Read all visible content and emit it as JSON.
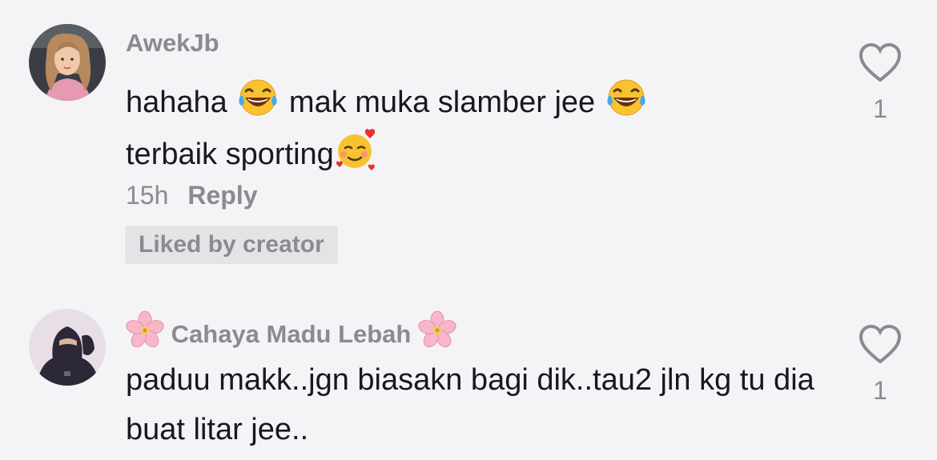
{
  "comments": [
    {
      "username": "AwekJb",
      "line1_a": "hahaha ",
      "line1_b": " mak muka slamber jee ",
      "line2": "terbaik sporting",
      "emoji_1": "face-with-tears-of-joy-icon",
      "emoji_2": "smiling-face-with-hearts-icon",
      "time": "15h",
      "reply_label": "Reply",
      "badge": "Liked by creator",
      "likes": "1"
    },
    {
      "username": "Cahaya Madu Lebah",
      "username_emoji": "cherry-blossom-icon",
      "text": "paduu makk..jgn biasakn bagi dik..tau2 jln kg tu dia buat litar jee..",
      "likes": "1"
    }
  ],
  "colors": {
    "background": "#f4f4f6",
    "text_primary": "#161823",
    "text_secondary": "#8a8a90",
    "badge_bg": "#e4e4e7",
    "heart_outline": "#8a8a90"
  }
}
